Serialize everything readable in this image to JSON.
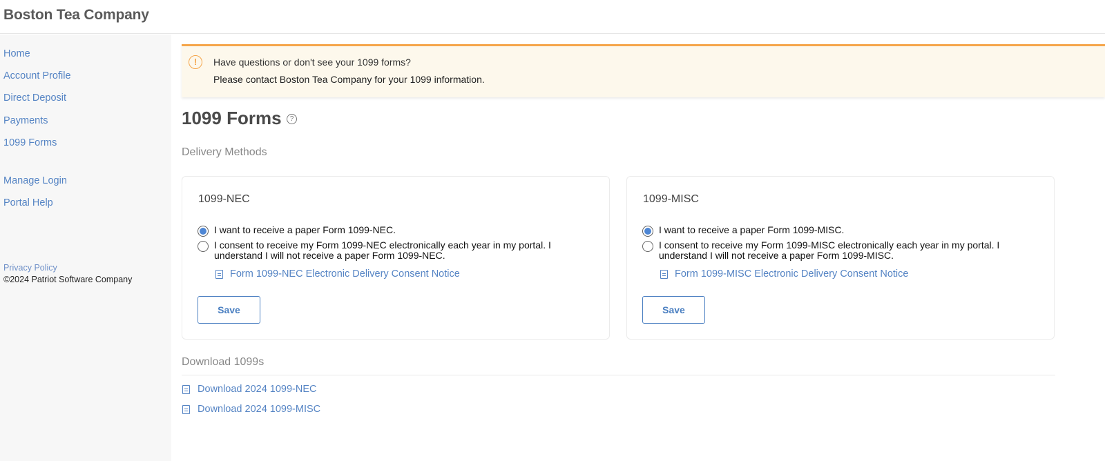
{
  "header": {
    "company_name": "Boston Tea Company"
  },
  "sidebar": {
    "nav_items": [
      {
        "label": "Home"
      },
      {
        "label": "Account Profile"
      },
      {
        "label": "Direct Deposit"
      },
      {
        "label": "Payments"
      },
      {
        "label": "1099 Forms"
      }
    ],
    "secondary_items": [
      {
        "label": "Manage Login"
      },
      {
        "label": "Portal Help"
      }
    ],
    "footer": {
      "privacy_label": "Privacy Policy",
      "copyright": "©2024 Patriot Software Company"
    }
  },
  "alert": {
    "icon": "exclamation-circle-icon",
    "icon_glyph": "!",
    "title": "Have questions or don't see your 1099 forms?",
    "body": "Please contact Boston Tea Company for your 1099 information.",
    "accent_color": "#f5a54a"
  },
  "page": {
    "title": "1099 Forms",
    "help_glyph": "?",
    "delivery_section_label": "Delivery Methods",
    "download_section_label": "Download 1099s"
  },
  "cards": [
    {
      "title": "1099-NEC",
      "options": [
        {
          "label": "I want to receive a paper Form 1099-NEC.",
          "checked": true
        },
        {
          "label": "I consent to receive my Form 1099-NEC electronically each year in my portal. I understand I will not receive a paper Form 1099-NEC.",
          "checked": false
        }
      ],
      "consent_link": "Form 1099-NEC Electronic Delivery Consent Notice",
      "save_label": "Save"
    },
    {
      "title": "1099-MISC",
      "options": [
        {
          "label": "I want to receive a paper Form 1099-MISC.",
          "checked": true
        },
        {
          "label": "I consent to receive my Form 1099-MISC electronically each year in my portal. I understand I will not receive a paper Form 1099-MISC.",
          "checked": false
        }
      ],
      "consent_link": "Form 1099-MISC Electronic Delivery Consent Notice",
      "save_label": "Save"
    }
  ],
  "downloads": [
    {
      "label": "Download 2024 1099-NEC"
    },
    {
      "label": "Download 2024 1099-MISC"
    }
  ],
  "colors": {
    "link": "#5584c4",
    "radio_selected": "#4e86d4",
    "alert_bg": "#fdf8ec"
  }
}
